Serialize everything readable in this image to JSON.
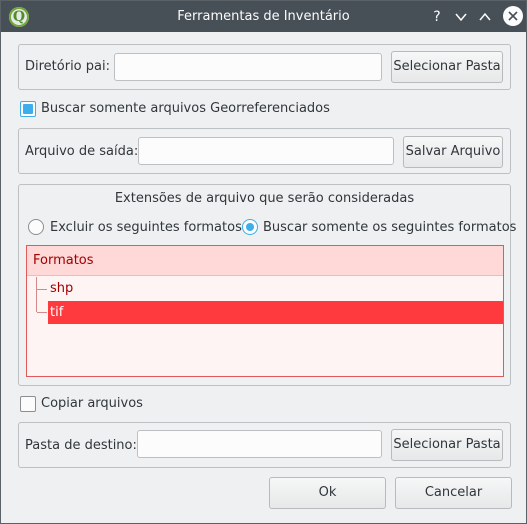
{
  "window": {
    "title": "Ferramentas de Inventário",
    "help_symbol": "?"
  },
  "parent_dir": {
    "label": "Diretório pai:",
    "value": "",
    "button": "Selecionar Pasta"
  },
  "georef_checkbox": {
    "label": "Buscar somente arquivos Georreferenciados",
    "checked": true
  },
  "output_file": {
    "label": "Arquivo de saída:",
    "value": "",
    "button": "Salvar Arquivo"
  },
  "extensions": {
    "title": "Extensões de arquivo que serão consideradas",
    "radio_exclude": "Excluir os seguintes formatos",
    "radio_only": "Buscar somente os seguintes formatos",
    "selected": "only",
    "tree_header": "Formatos",
    "formats": [
      "shp",
      "tif"
    ],
    "selected_format": "tif"
  },
  "copy_files": {
    "label": "Copiar arquivos",
    "checked": false
  },
  "dest_folder": {
    "label": "Pasta de destino:",
    "value": "",
    "button": "Selecionar Pasta"
  },
  "footer": {
    "ok": "Ok",
    "cancel": "Cancelar"
  },
  "colors": {
    "titlebar": "#475057",
    "accent": "#3daee9",
    "selection_red": "#ff3a3e",
    "tree_header_bg": "#ffd8d8"
  }
}
